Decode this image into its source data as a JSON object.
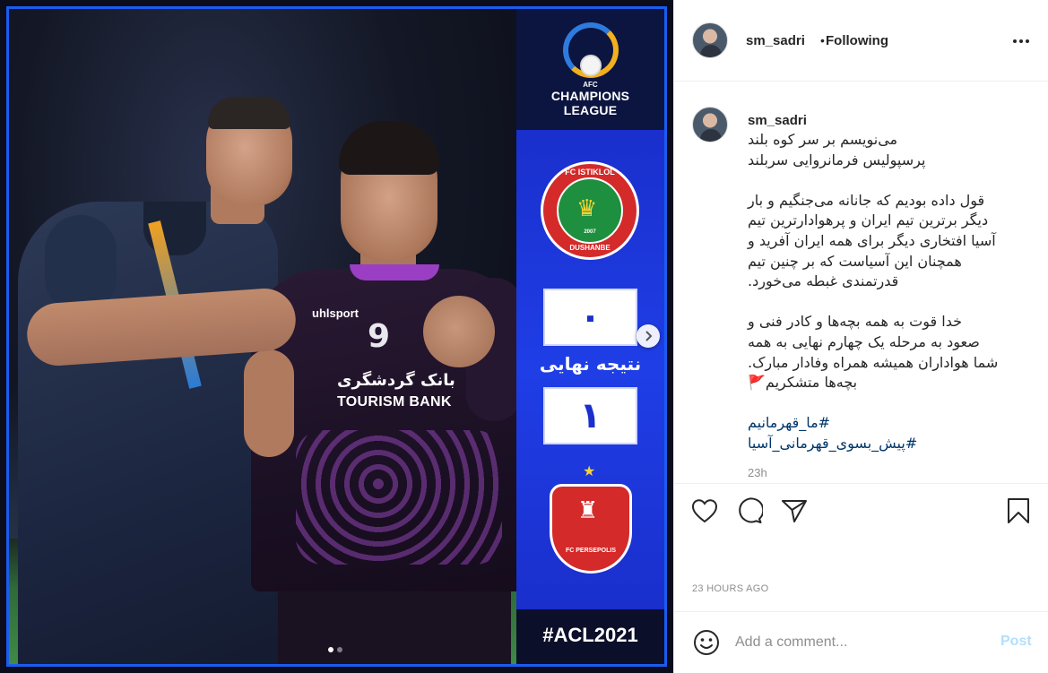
{
  "post": {
    "image_text": {
      "league_small": "AFC",
      "league_line1": "CHAMPIONS",
      "league_line2": "LEAGUE",
      "home_team_top": "FC ISTIKLOL",
      "home_team_bottom": "DUSHANBE",
      "home_team_year": "2007",
      "home_score": "٠",
      "final_label": "نتیجه نهایی",
      "away_score": "١",
      "away_team": "FC PERSEPOLIS",
      "hashtag": "#ACL2021",
      "shirt_number": "9",
      "shirt_brand": "uhlsport",
      "shirt_sponsor_fa": "بانک گردشگری",
      "shirt_sponsor": "TOURISM BANK"
    },
    "carousel": {
      "current": 1,
      "total": 2
    }
  },
  "header": {
    "username": "sm_sadri",
    "separator": "•",
    "follow_status": "Following"
  },
  "caption": {
    "username": "sm_sadri",
    "lines": [
      "می‌نویسم بر سر کوه بلند",
      "پرسپولیس فرمانروایی سربلند",
      "",
      "قول داده بودیم که جانانه می‌جنگیم و بار",
      "دیگر برترین تیم ایران و پرهوادارترین تیم",
      "آسیا افتخاری دیگر برای همه ایران آفرید و",
      "همچنان این آسیاست که بر چنین تیم",
      "قدرتمندی غبطه می‌خورد.",
      "",
      "خدا قوت به همه بچه‌ها و کادر فنی و",
      "صعود به مرحله یک چهارم نهایی به همه",
      "شما هواداران همیشه همراه وفادار مبارک.",
      "بچه‌ها متشکریم🚩"
    ],
    "hashtags": [
      "#ما_قهرمانیم",
      "#پیش_بسوی_قهرمانی_آسیا"
    ],
    "relative_time": "23h"
  },
  "meta": {
    "timestamp": "23 HOURS AGO"
  },
  "comment": {
    "placeholder": "Add a comment...",
    "post_label": "Post"
  },
  "icons": {
    "like": "heart-icon",
    "comment": "comment-icon",
    "share": "share-icon",
    "save": "bookmark-icon",
    "more": "more-icon",
    "emoji": "emoji-icon",
    "next": "chevron-right-icon"
  },
  "colors": {
    "accent": "#1a5cf0",
    "panel_blue": "#1f3ee6",
    "persepolis_red": "#d42a2a",
    "hashtag_link": "#00376b",
    "post_disabled": "#b2dffc"
  }
}
